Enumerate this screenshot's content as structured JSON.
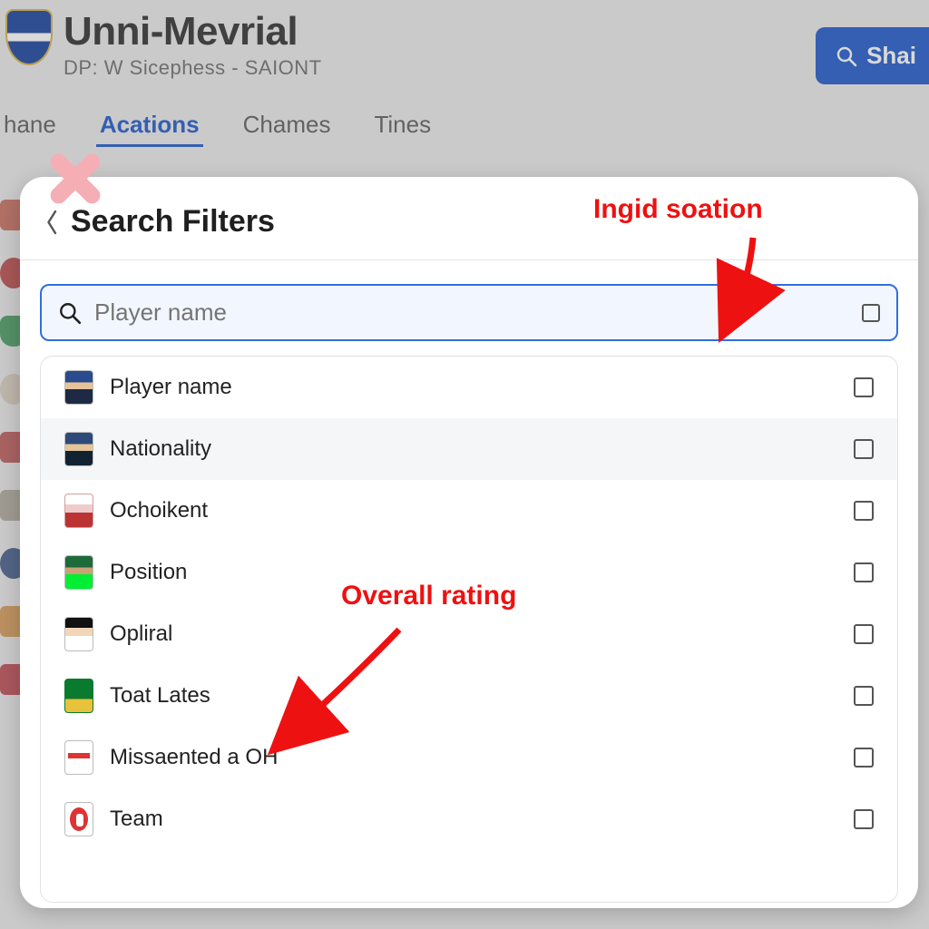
{
  "header": {
    "title": "Unni-Mevrial",
    "subtitle": "DP: W Sicephess - SAIONT",
    "share_label": "Shai"
  },
  "tabs": [
    {
      "label": "hane",
      "active": false
    },
    {
      "label": "Acations",
      "active": true
    },
    {
      "label": "Chames",
      "active": false
    },
    {
      "label": "Tines",
      "active": false
    }
  ],
  "panel": {
    "title": "Search Filters",
    "search_placeholder": "Player name",
    "items": [
      {
        "label": "Player name"
      },
      {
        "label": "Nationality"
      },
      {
        "label": "Ochoikent"
      },
      {
        "label": "Position"
      },
      {
        "label": "Opliral"
      },
      {
        "label": "Toat Lates"
      },
      {
        "label": "Missaented a OH"
      },
      {
        "label": "Team"
      }
    ]
  },
  "annotations": {
    "top_label": "Ingid soation",
    "mid_label": "Overall rating"
  }
}
